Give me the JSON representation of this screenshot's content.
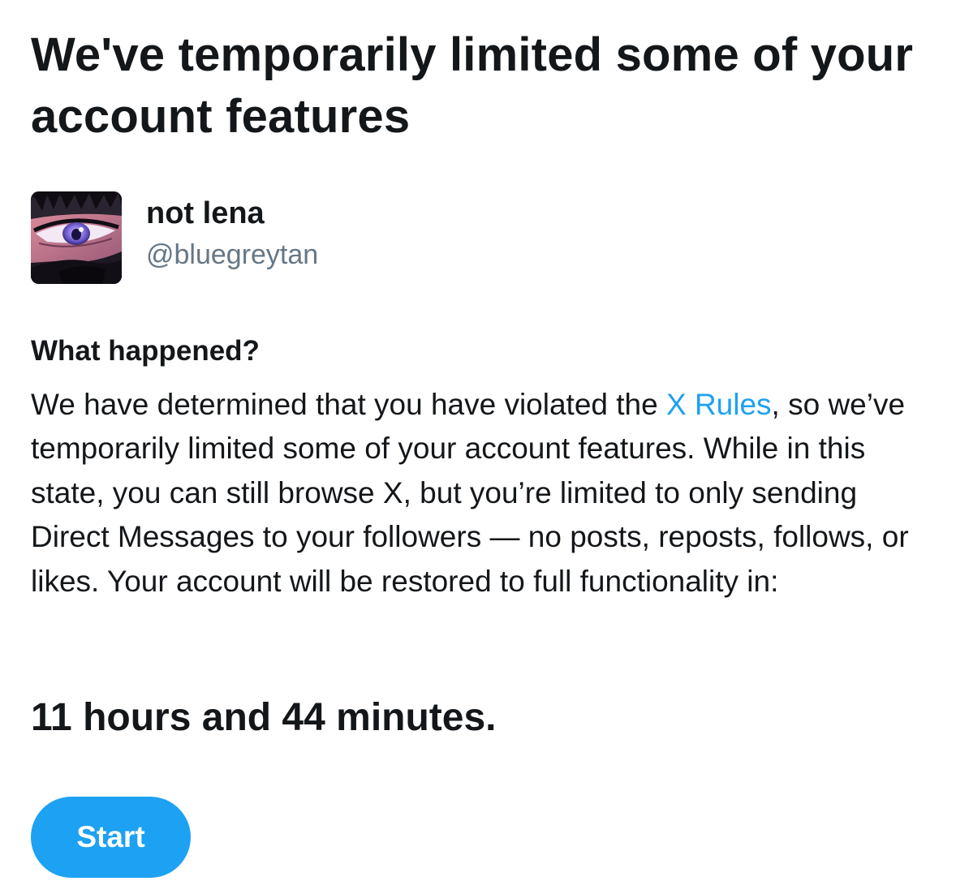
{
  "header": {
    "title": "We've temporarily limited some of your account features"
  },
  "user": {
    "display_name": "not lena",
    "handle": "@bluegreytan",
    "avatar_icon": "anime-eye-avatar"
  },
  "notice": {
    "heading": "What happened?",
    "body_before_link": "We have determined that you have violated the ",
    "link_text": "X Rules",
    "body_after_link": ", so we’ve temporarily limited some of your account features. While in this state, you can still browse X, but you’re limited to only sending Direct Messages to your followers — no posts, reposts, follows, or likes. Your account will be restored to full functionality in:",
    "countdown": "11 hours and 44 minutes."
  },
  "actions": {
    "start_label": "Start"
  },
  "colors": {
    "accent": "#1da1f2",
    "text_primary": "#14171a",
    "text_secondary": "#657786",
    "background": "#ffffff"
  }
}
